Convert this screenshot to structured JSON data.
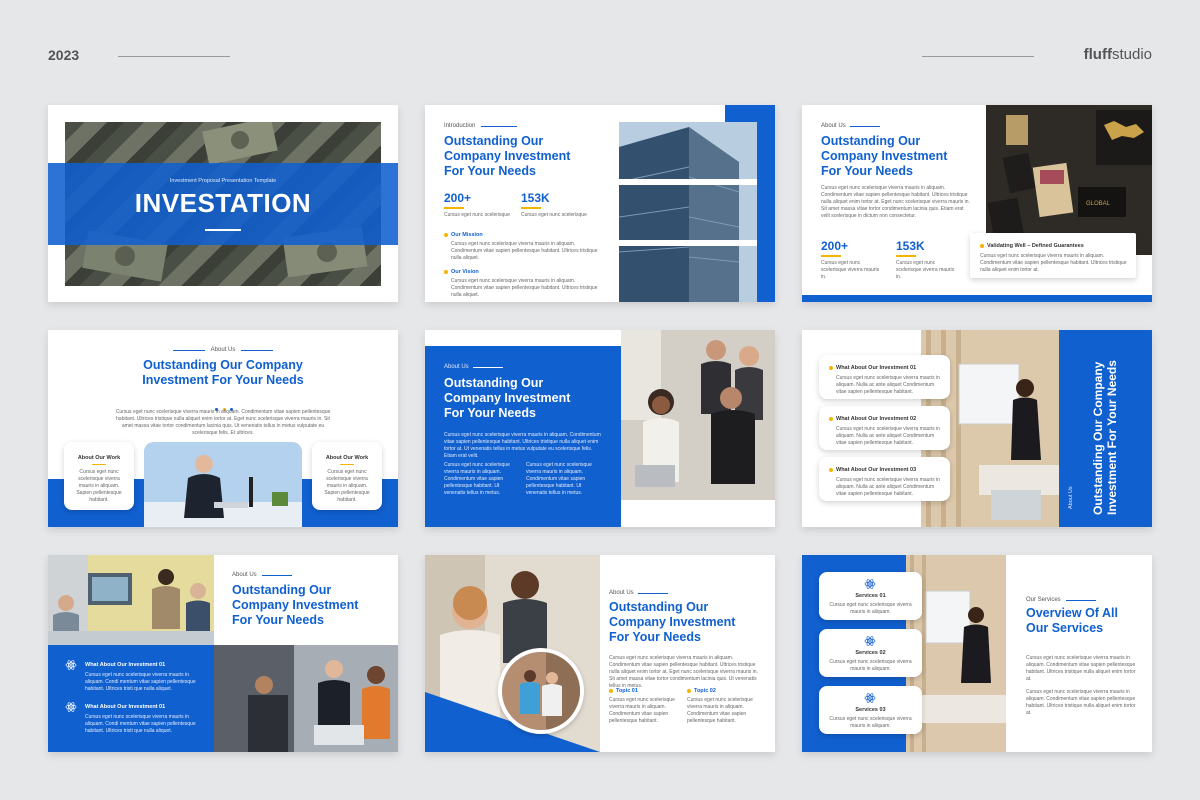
{
  "header": {
    "year": "2023",
    "brand_bold": "fluff",
    "brand_rest": "studio"
  },
  "colors": {
    "primary": "#1060d0",
    "accent": "#f4b400",
    "background": "#e6e7e9"
  },
  "slide1": {
    "subtitle": "Investment Proposal Presentation Template",
    "title": "INVESTATION"
  },
  "slide2": {
    "label": "Introduction",
    "title1": "Outstanding Our",
    "title2": "Company Investment",
    "title3": "For Your Needs",
    "stat1": "200+",
    "stat1_desc": "Cursus eget nunc scelerisque",
    "stat2": "153K",
    "stat2_desc": "Cursus eget nunc scelerisque",
    "mission": "Our Mission",
    "mission_text": "Cursus eget nunc scelerisque viverra mauris in aliquam. Condimentum vitae sapien pellentesque habitant. Ultrices tristique nulla aliquet.",
    "vision": "Our Vision",
    "vision_text": "Cursus eget nunc scelerisque viverra mauris in aliquam. Condimentum vitae sapien pellentesque habitant. Ultrices tristique nulla aliquet."
  },
  "slide3": {
    "label": "About Us",
    "title1": "Outstanding Our",
    "title2": "Company Investment",
    "title3": "For Your Needs",
    "body": "Cursus eget nunc scelerisque viverra mauris in aliquam. Condimentum vitae sapien pellentesque habitant. Ultrices tristique nulla aliquet enim tortor at. Eget nunc scelerisque viverra mauris in. Sit amet massa vitae tortor condimentum lacinia quis. Etiam erat velit scelerisque in dictum non consectetur.",
    "stat1": "200+",
    "stat1_desc": "Cursus eget nunc scelerisque viverra mauris in.",
    "stat2": "153K",
    "stat2_desc": "Cursus eget nunc scelerisque viverra mauris in.",
    "card_title": "Validating Well – Defined Guarantees",
    "card_text": "Cursus eget nunc scelerisque viverra mauris in aliquam. Condimentum vitae sapien pellentesque habitant. Ultrices tristique nulla aliquet enim tortor at."
  },
  "slide4": {
    "label": "About Us",
    "title1": "Outstanding Our Company",
    "title2": "Investment For Your Needs",
    "body": "Cursus eget nunc scelerisque viverra mauris in aliquam. Condimentum vitae sapien pellentesque habitant. Ultrices tristique nulla aliquet enim tortor at. Eget nunc scelerisque viverra mauris in. Sit amet massa vitae tortor condimentum lacinia quis. Ut venenatis tellus in metus vulputate eu scelerisque felis. Et ultrices.",
    "card1_title": "About Our Work",
    "card1_text": "Cursus eget nunc scelerisque viverra mauris in aliquam. Sapien pellentesque habitant.",
    "card2_title": "About Our Work",
    "card2_text": "Cursus eget nunc scelerisque viverra mauris in aliquam. Sapien pellentesque habitant."
  },
  "slide5": {
    "label": "About Us",
    "title1": "Outstanding Our",
    "title2": "Company Investment",
    "title3": "For Your Needs",
    "body": "Cursus eget nunc scelerisque viverra mauris in aliquam. Condimentum vitae sapien pellentesque habitant. Ultrices tristique nulla aliquet enim tortor at. Ut venenatis tellus in metus vulputate eu scelerisque felis. Etiam erat velit.",
    "col1": "Cursus eget nunc scelerisque viverra mauris in aliquam. Condimentum vitae sapien pellentesque habitant. Ut venenatis tellus in metus.",
    "col2": "Cursus eget nunc scelerisque viverra mauris in aliquam. Condimentum vitae sapien pellentesque habitant. Ut venenatis tellus in metus."
  },
  "slide6": {
    "items": [
      {
        "title": "What About Our Investment 01",
        "text": "Cursus eget nunc scelerisque viverra mauris in aliquam. Nulla ac ante aliquet Condimentum vitae sapien pellentesque habitant."
      },
      {
        "title": "What About Our Investment 02",
        "text": "Cursus eget nunc scelerisque viverra mauris in aliquam. Nulla ac ante aliquet Condimentum vitae sapien pellentesque habitant."
      },
      {
        "title": "What About Our Investment 03",
        "text": "Cursus eget nunc scelerisque viverra mauris in aliquam. Nulla ac ante aliquet Condimentum vitae sapien pellentesque habitant."
      }
    ],
    "label": "About Us",
    "title": "Outstanding Our Company Investment For Your Needs"
  },
  "slide7": {
    "label": "About Us",
    "title1": "Outstanding Our",
    "title2": "Company Investment",
    "title3": "For Your Needs",
    "items": [
      {
        "title": "What About Our Investment 01",
        "text": "Cursus eget nunc scelerisque viverra mauris in aliquam. Condi mentum vitae sapien pellentesque habitant. Ultrices tristi que nulla aliquet."
      },
      {
        "title": "What About Our Investment 01",
        "text": "Cursus eget nunc scelerisque viverra mauris in aliquam. Condi mentum vitae sapien pellentesque habitant. Ultrices tristi que nulla aliquet."
      }
    ]
  },
  "slide8": {
    "label": "About Us",
    "title1": "Outstanding Our",
    "title2": "Company Investment",
    "title3": "For Your Needs",
    "body": "Cursus eget nunc scelerisque viverra mauris in aliquam. Condimentum vitae sapien pellentesque habitant. Ultrices tristique nulla aliquet enim tortor at. Eget nunc scelerisque viverra mauris in. Sit amet massa vitae tortor condimentum lacinia quis. Ut venenatis tellus in metus.",
    "topic1": "Topic 01",
    "topic1_text": "Cursus eget nunc scelerisque viverra mauris in aliquam. Condimentum vitae sapien pellentesque habitant.",
    "topic2": "Topic 02",
    "topic2_text": "Cursus eget nunc scelerisque viverra mauris in aliquam. Condimentum vitae sapien pellentesque habitant."
  },
  "slide9": {
    "services": [
      {
        "title": "Services 01",
        "text": "Cursus eget nunc scelerisque viverra mauris in aliquam."
      },
      {
        "title": "Services 02",
        "text": "Cursus eget nunc scelerisque viverra mauris in aliquam."
      },
      {
        "title": "Services 03",
        "text": "Cursus eget nunc scelerisque viverra mauris in aliquam."
      }
    ],
    "label": "Our Services",
    "title1": "Overview Of All",
    "title2": "Our Services",
    "body1": "Cursus eget nunc scelerisque viverra mauris in aliquam. Condimentum vitae sapien pellentesque habitant. Ultrices tristique nulla aliquet enim tortor at.",
    "body2": "Cursus eget nunc scelerisque viverra mauris in aliquam. Condimentum vitae sapien pellentesque habitant. Ultrices tristique nulla aliquet enim tortor at."
  }
}
